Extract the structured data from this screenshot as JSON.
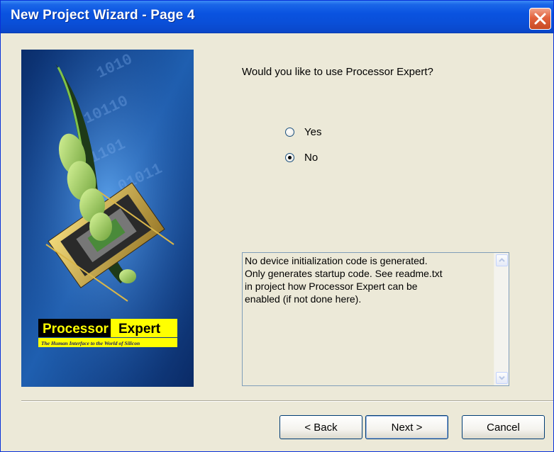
{
  "window": {
    "title": "New Project Wizard - Page  4",
    "close_icon": "close-icon"
  },
  "sidepanel": {
    "logo_left": "Processor",
    "logo_right": "Expert",
    "logo_tm": "TM",
    "tagline": "The Human Interface to the World of Silicon",
    "colors": {
      "background": "#0b3a7a",
      "logo_left_bg": "#000000",
      "logo_right_bg": "#ffff00"
    }
  },
  "question": "Would you like to use Processor Expert?",
  "options": [
    {
      "label": "Yes",
      "selected": false
    },
    {
      "label": "No",
      "selected": true
    }
  ],
  "info_text": "No device initialization code is generated.\nOnly generates startup code. See readme.txt\nin project how Processor Expert can be\nenabled (if not done here).",
  "buttons": {
    "back": "< Back",
    "next": "Next >",
    "cancel": "Cancel"
  }
}
